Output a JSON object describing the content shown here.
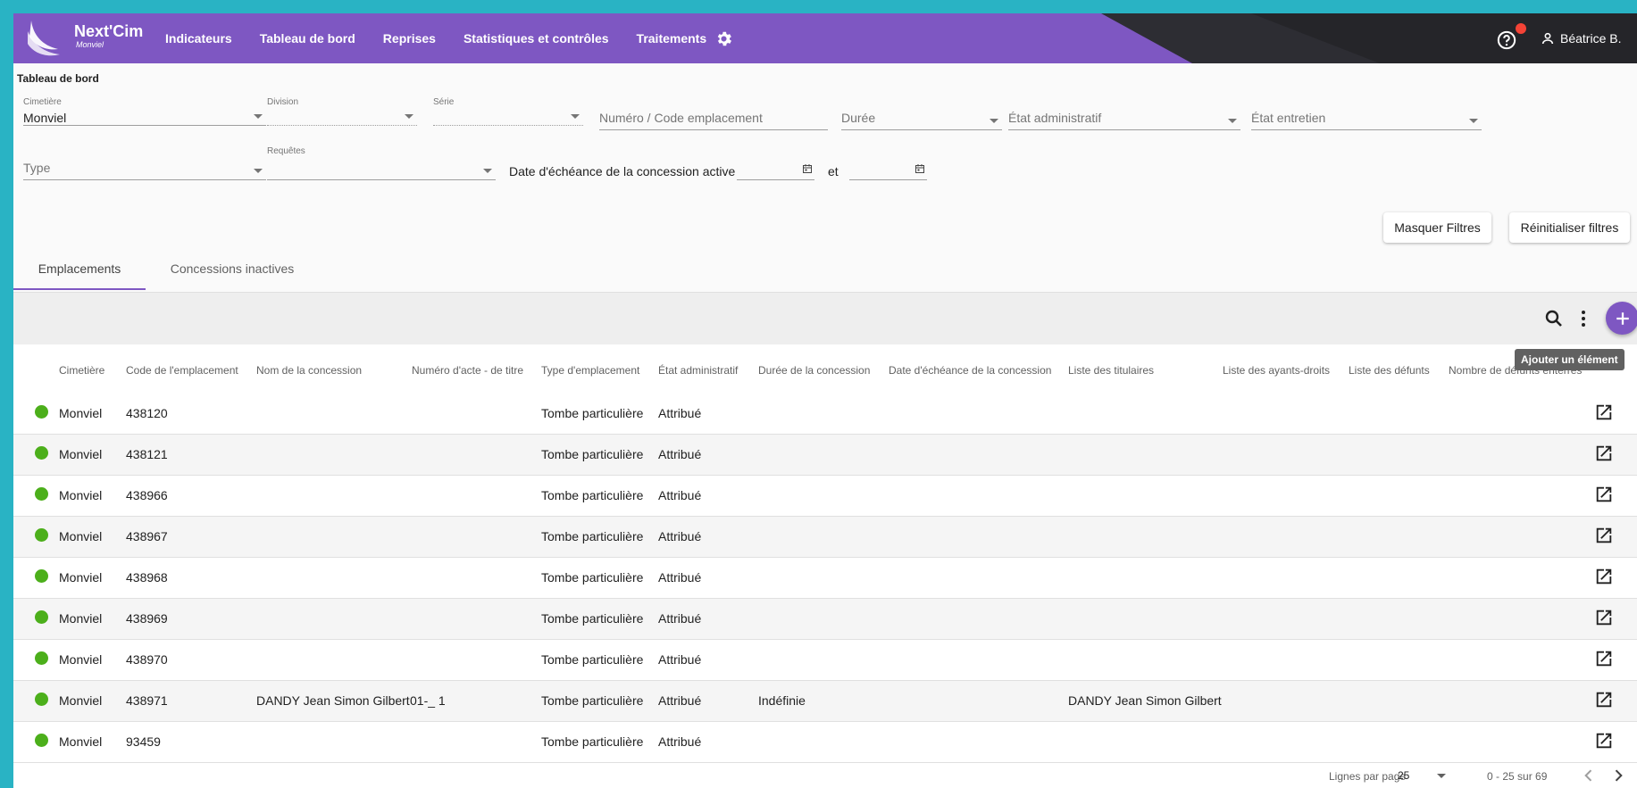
{
  "header": {
    "brand": "Next'Cim",
    "brand_sub": "Monviel",
    "nav": [
      "Indicateurs",
      "Tableau de bord",
      "Reprises",
      "Statistiques et contrôles",
      "Traitements"
    ],
    "user": "Béatrice B.",
    "colors": {
      "bar": "#7e57c2",
      "dark": "#2d2d33",
      "notification": "#f44336"
    }
  },
  "page_title": "Tableau de bord",
  "filters": {
    "cimetiere": {
      "label": "Cimetière",
      "value": "Monviel"
    },
    "division": {
      "label": "Division"
    },
    "serie": {
      "label": "Série"
    },
    "numero": {
      "placeholder": "Numéro / Code emplacement"
    },
    "duree": {
      "placeholder": "Durée"
    },
    "etat_admin": {
      "placeholder": "État administratif"
    },
    "etat_entretien": {
      "placeholder": "État entretien"
    },
    "type": {
      "placeholder": "Type"
    },
    "requetes": {
      "label": "Requêtes"
    },
    "date_label": "Date d'échéance de la concession active",
    "date_and": "et"
  },
  "buttons": {
    "hide_filters": "Masquer Filtres",
    "reset_filters": "Réinitialiser filtres"
  },
  "tabs": [
    "Emplacements",
    "Concessions inactives"
  ],
  "tooltip": "Ajouter un élément",
  "table": {
    "headers": [
      "Cimetière",
      "Code de l'emplacement",
      "Nom de la concession",
      "Numéro d'acte - de titre",
      "Type d'emplacement",
      "État administratif",
      "Durée de la concession",
      "Date d'échéance de la concession",
      "Liste des titulaires",
      "Liste des ayants-droits",
      "Liste des défunts",
      "Nombre de défunts enterrés"
    ],
    "rows": [
      {
        "cimetiere": "Monviel",
        "code": "438120",
        "nom": "",
        "acte": "",
        "type": "Tombe particulière",
        "etat": "Attribué",
        "duree": "",
        "titulaires": ""
      },
      {
        "cimetiere": "Monviel",
        "code": "438121",
        "nom": "",
        "acte": "",
        "type": "Tombe particulière",
        "etat": "Attribué",
        "duree": "",
        "titulaires": ""
      },
      {
        "cimetiere": "Monviel",
        "code": "438966",
        "nom": "",
        "acte": "",
        "type": "Tombe particulière",
        "etat": "Attribué",
        "duree": "",
        "titulaires": ""
      },
      {
        "cimetiere": "Monviel",
        "code": "438967",
        "nom": "",
        "acte": "",
        "type": "Tombe particulière",
        "etat": "Attribué",
        "duree": "",
        "titulaires": ""
      },
      {
        "cimetiere": "Monviel",
        "code": "438968",
        "nom": "",
        "acte": "",
        "type": "Tombe particulière",
        "etat": "Attribué",
        "duree": "",
        "titulaires": ""
      },
      {
        "cimetiere": "Monviel",
        "code": "438969",
        "nom": "",
        "acte": "",
        "type": "Tombe particulière",
        "etat": "Attribué",
        "duree": "",
        "titulaires": ""
      },
      {
        "cimetiere": "Monviel",
        "code": "438970",
        "nom": "",
        "acte": "",
        "type": "Tombe particulière",
        "etat": "Attribué",
        "duree": "",
        "titulaires": ""
      },
      {
        "cimetiere": "Monviel",
        "code": "438971",
        "nom": "DANDY Jean Simon Gilbert",
        "acte": "01-_ 1",
        "type": "Tombe particulière",
        "etat": "Attribué",
        "duree": "Indéfinie",
        "titulaires": "DANDY Jean Simon Gilbert"
      },
      {
        "cimetiere": "Monviel",
        "code": "93459",
        "nom": "",
        "acte": "",
        "type": "Tombe particulière",
        "etat": "Attribué",
        "duree": "",
        "titulaires": ""
      }
    ],
    "status_color": "#4caf1b"
  },
  "pagination": {
    "label": "Lignes par page",
    "per_page": "25",
    "range": "0 - 25 sur 69"
  }
}
